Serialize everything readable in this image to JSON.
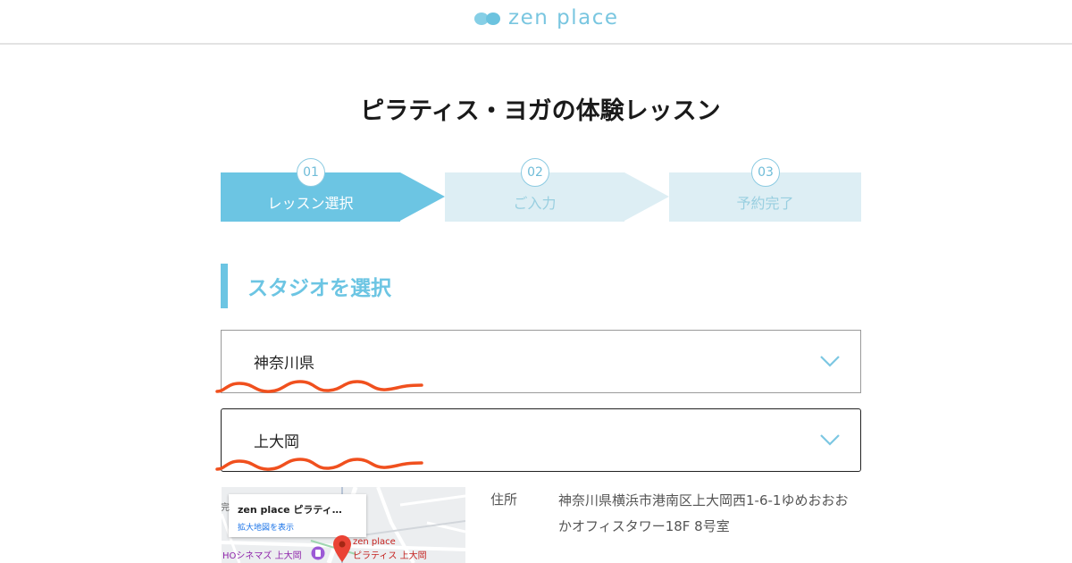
{
  "header": {
    "logo_text": "zen place",
    "brand_color": "#79c6e0"
  },
  "page": {
    "title": "ピラティス・ヨガの体験レッスン"
  },
  "stepper": {
    "steps": [
      {
        "number": "01",
        "label": "レッスン選択",
        "state": "active"
      },
      {
        "number": "02",
        "label": "ご入力",
        "state": "inactive"
      },
      {
        "number": "03",
        "label": "予約完了",
        "state": "inactive"
      }
    ],
    "active_color": "#6cc5e3",
    "inactive_color": "#ddeef4"
  },
  "section": {
    "heading": "スタジオを選択"
  },
  "selects": {
    "prefecture": {
      "value": "神奈川県",
      "icon": "chevron-down-icon"
    },
    "studio": {
      "value": "上大岡",
      "icon": "chevron-down-icon"
    },
    "annotation_color": "#f0501e"
  },
  "map": {
    "card_title": "zen place ピラティ…",
    "card_link": "拡大地図を表示",
    "place_label_line1": "zen place",
    "place_label_line2": "ピラティス 上大岡",
    "nearby_label": "HOシネマズ 上大岡",
    "edge_label": "完"
  },
  "address": {
    "label": "住所",
    "value": "神奈川県横浜市港南区上大岡西1-6-1ゆめおおおかオフィスタワー18F 8号室"
  }
}
